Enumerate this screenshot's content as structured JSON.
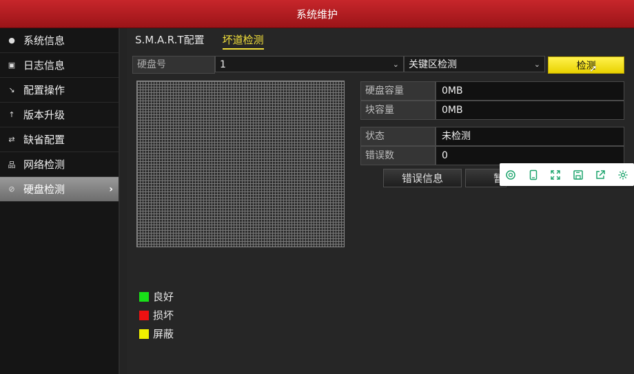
{
  "window": {
    "title": "系统维护"
  },
  "sidebar": {
    "items": [
      {
        "label": "系统信息",
        "icon": "info-icon"
      },
      {
        "label": "日志信息",
        "icon": "log-icon"
      },
      {
        "label": "配置操作",
        "icon": "config-icon"
      },
      {
        "label": "版本升级",
        "icon": "upgrade-icon"
      },
      {
        "label": "缺省配置",
        "icon": "default-icon"
      },
      {
        "label": "网络检测",
        "icon": "network-icon"
      },
      {
        "label": "硬盘检测",
        "icon": "disk-check-icon",
        "active": true
      }
    ]
  },
  "tabs": [
    {
      "label": "S.M.A.R.T配置"
    },
    {
      "label": "坏道检测",
      "active": true
    }
  ],
  "form": {
    "disk_label": "硬盘号",
    "disk_value": "1",
    "mode_value": "关键区检测",
    "detect_button": "检测"
  },
  "info": {
    "capacity_key": "硬盘容量",
    "capacity_val": "0MB",
    "block_key": "块容量",
    "block_val": "0MB",
    "status_key": "状态",
    "status_val": "未检测",
    "errors_key": "错误数",
    "errors_val": "0"
  },
  "buttons": {
    "error_info": "错误信息",
    "partial": "暂"
  },
  "legend": [
    {
      "label": "良好",
      "color": "#19e019"
    },
    {
      "label": "损坏",
      "color": "#ee1111"
    },
    {
      "label": "屏蔽",
      "color": "#f2f200"
    }
  ],
  "floating_toolbar": {
    "icons": [
      "search-icon",
      "tablet-icon",
      "expand-icon",
      "save-icon",
      "share-icon",
      "settings-icon"
    ],
    "accent": "#1aa36b"
  }
}
